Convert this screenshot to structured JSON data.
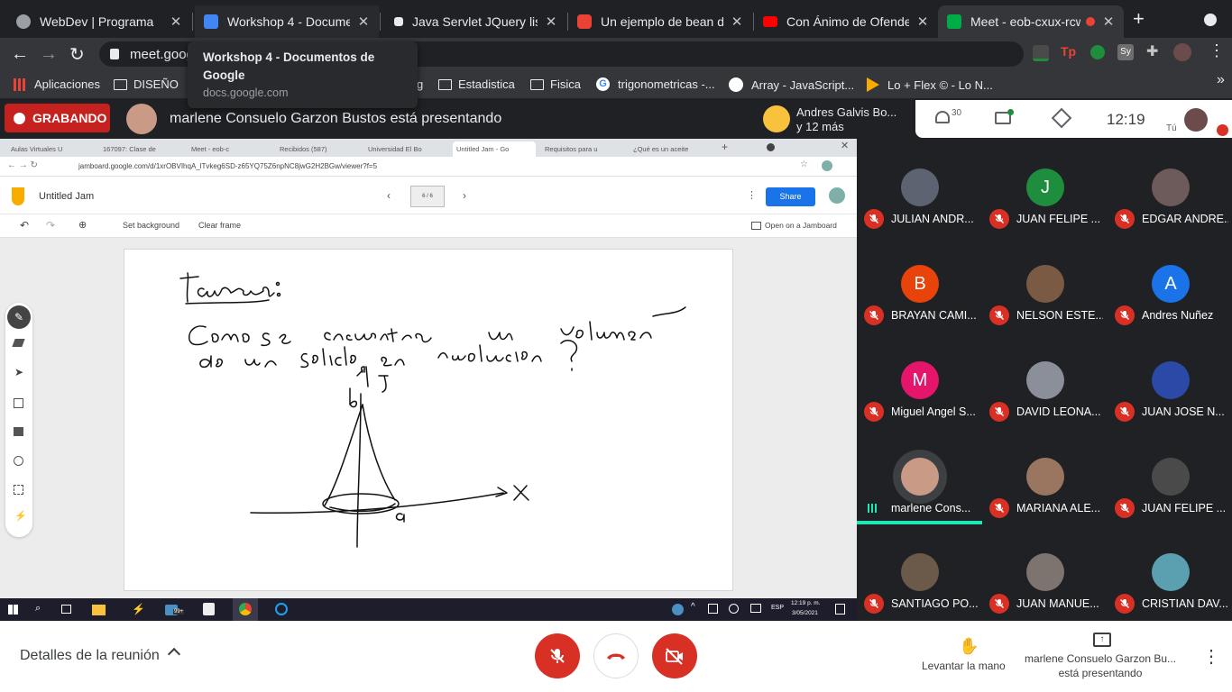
{
  "browser": {
    "tabs": [
      {
        "title": "WebDev | Programa",
        "favicon_color": "#9aa0a6"
      },
      {
        "title": "Workshop 4 - Documentos",
        "favicon_color": "#4285f4"
      },
      {
        "title": "Java Servlet JQuery list t",
        "favicon_color": "#e8eaed"
      },
      {
        "title": "Un ejemplo de bean de s",
        "favicon_color": "#ea4335"
      },
      {
        "title": "Con Ánimo de Ofender : l",
        "favicon_color": "#ff0000"
      },
      {
        "title": "Meet - eob-cxux-rcw",
        "favicon_color": "#00ac47"
      }
    ],
    "url": "meet.goog",
    "bookmarks": [
      "Aplicaciones",
      "DISEÑO",
      "g",
      "Estadistica",
      "Fisica",
      "trigonometricas -...",
      "Array - JavaScript...",
      "Lo + Flex © - Lo N..."
    ],
    "tooltip": {
      "title": "Workshop 4 - Documentos de Google",
      "domain": "docs.google.com"
    }
  },
  "meet": {
    "recording_label": "GRABANDO",
    "presenting_text": "marlene Consuelo Garzon Bustos está presentando",
    "side_speaker": {
      "name": "Andres Galvis Bo...",
      "more": "y 12 más"
    },
    "participant_count": "30",
    "time": "12:19",
    "you_label": "Tú",
    "accent": "#1a73e8",
    "danger": "#d93025",
    "participants": [
      {
        "name": "JULIAN ANDR...",
        "initial": "",
        "color": "#5b6470"
      },
      {
        "name": "JUAN FELIPE ...",
        "initial": "J",
        "color": "#1e8e3e"
      },
      {
        "name": "EDGAR ANDRE...",
        "initial": "",
        "color": "#6d5a5a"
      },
      {
        "name": "BRAYAN CAMI...",
        "initial": "B",
        "color": "#e8430a"
      },
      {
        "name": "NELSON ESTE...",
        "initial": "",
        "color": "#7a5a43"
      },
      {
        "name": "Andres Nuñez",
        "initial": "A",
        "color": "#1a73e8"
      },
      {
        "name": "Miguel Angel S...",
        "initial": "M",
        "color": "#e5156b"
      },
      {
        "name": "DAVID LEONA...",
        "initial": "",
        "color": "#8a8f9a"
      },
      {
        "name": "JUAN JOSE N...",
        "initial": "",
        "color": "#2b4aa8"
      },
      {
        "name": "marlene Cons...",
        "initial": "",
        "color": "#c99a86"
      },
      {
        "name": "MARIANA ALE...",
        "initial": "",
        "color": "#9a7560"
      },
      {
        "name": "JUAN FELIPE ...",
        "initial": "",
        "color": "#4a4a4a"
      },
      {
        "name": "SANTIAGO PO...",
        "initial": "",
        "color": "#6b5a4a"
      },
      {
        "name": "JUAN MANUE...",
        "initial": "",
        "color": "#7d7470"
      },
      {
        "name": "CRISTIAN DAV...",
        "initial": "",
        "color": "#5aa0b0"
      }
    ],
    "bottom": {
      "details": "Detalles de la reunión",
      "raise_hand": "Levantar la mano",
      "presenting_line1": "marlene Consuelo Garzon Bu...",
      "presenting_line2": "está presentando"
    }
  },
  "shared_screen": {
    "tabs": [
      "Aulas Virtuales U",
      "167097: Clase de",
      "Meet - eob-c",
      "Recibidos (587)",
      "Universidad El Bo",
      "Untitled Jam - Go",
      "Requisitos para u",
      "¿Qué es un aceite"
    ],
    "url": "jamboard.google.com/d/1xrOBVIhqA_lTvkeg6SD-z65YQ75Z6npNC8jwG2H2BGw/viewer?f=5",
    "jam_title": "Untitled Jam",
    "frame_indicator": "6 / 6",
    "share_label": "Share",
    "set_background": "Set background",
    "clear_frame": "Clear frame",
    "open_jamboard": "Open on a Jamboard",
    "taskbar_lang": "ESP",
    "taskbar_time": "12:19 p. m.",
    "taskbar_date": "3/05/2021",
    "taskbar_badge": "99+"
  }
}
